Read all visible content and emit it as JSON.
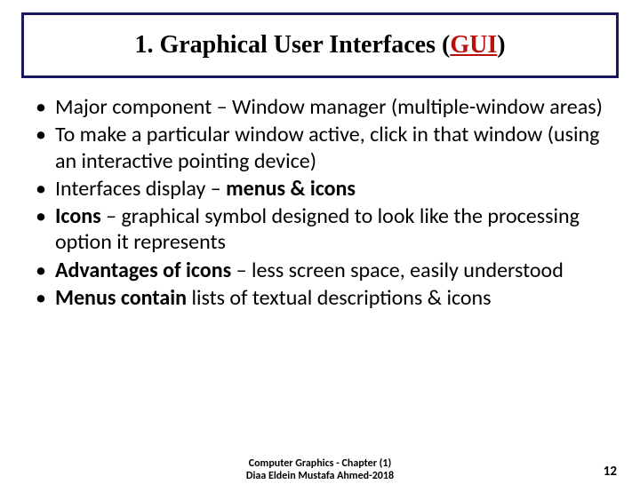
{
  "title": {
    "prefix": "1. Graphical User Interfaces ",
    "open_paren": "(",
    "gui": "GUI",
    "close_paren": ")"
  },
  "bullets": {
    "b1_a": "Major component – Window manager (multiple-window areas)",
    "b2_a": "To make a particular window active, click in that window (using an interactive pointing device)",
    "b3_a": "Interfaces display – ",
    "b3_b": "menus & icons",
    "b4_a": "Icons",
    "b4_b": " – graphical symbol designed to look like the processing option it represents",
    "b5_a": "Advantages of icons",
    "b5_b": " – less screen space, easily understood",
    "b6_a": "Menus contain",
    "b6_b": " lists of textual descriptions & icons"
  },
  "footer": {
    "line1": "Computer Graphics - Chapter (1)",
    "line2": "Diaa Eldein Mustafa Ahmed-2018"
  },
  "page_number": "12"
}
